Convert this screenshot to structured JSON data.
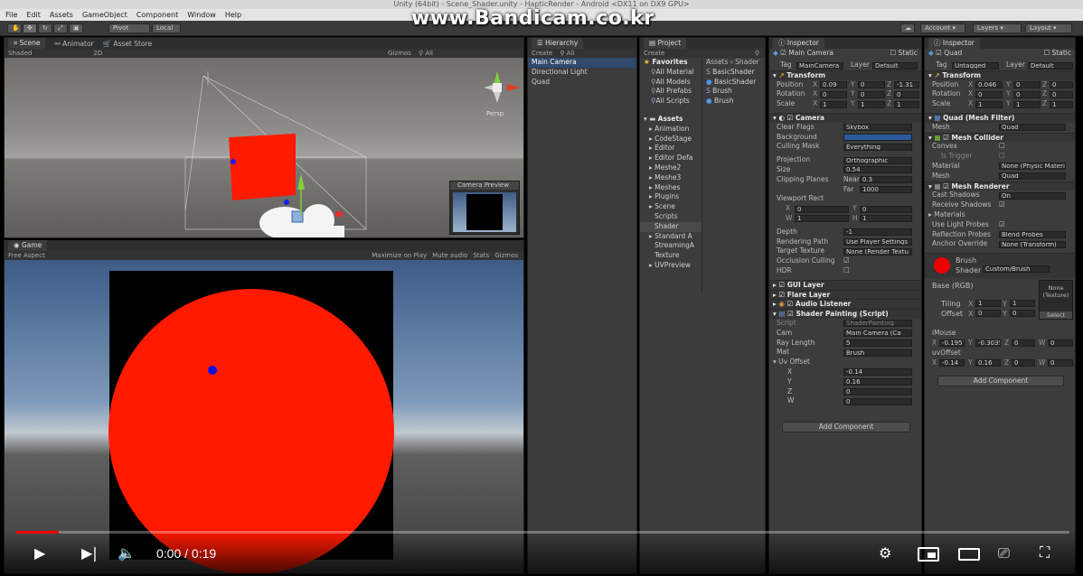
{
  "window": {
    "title": "Unity (64bit) - Scene_Shader.unity - HapticRender - Android <DX11 on DX9 GPU>"
  },
  "watermark": "www.Bandicam.co.kr",
  "menu": [
    "File",
    "Edit",
    "Assets",
    "GameObject",
    "Component",
    "Window",
    "Help"
  ],
  "toolbar": {
    "pivot": "Pivot",
    "local": "Local",
    "account": "Account",
    "layers": "Layers",
    "layout": "Layout"
  },
  "scene": {
    "tabs": [
      "Scene",
      "Animator",
      "Asset Store"
    ],
    "shading": "Shaded",
    "mode2d": "2D",
    "gizmos": "Gizmos",
    "search": "All",
    "persp": "Persp",
    "camera_preview": "Camera Preview"
  },
  "game": {
    "tab": "Game",
    "aspect": "Free Aspect",
    "options": [
      "Maximize on Play",
      "Mute audio",
      "Stats",
      "Gizmos"
    ]
  },
  "hierarchy": {
    "tab": "Hierarchy",
    "create": "Create",
    "search": "All",
    "items": [
      "Main Camera",
      "Directional Light",
      "Quad"
    ]
  },
  "project": {
    "tab": "Project",
    "create": "Create",
    "favorites_label": "Favorites",
    "favorites": [
      "All Material",
      "All Models",
      "All Prefabs",
      "All Scripts"
    ],
    "breadcrumb": "Assets › Shader",
    "files": [
      "BasicShader",
      "BasicShader",
      "Brush",
      "Brush"
    ],
    "assets_label": "Assets",
    "folders": [
      "Animation",
      "CodeStage",
      "Editor",
      "Editor Defa",
      "Meshe2",
      "Meshe3",
      "Meshes",
      "Plugins",
      "Scene",
      "Scripts",
      "Shader",
      "Standard A",
      "StreamingA",
      "Texture",
      "UVPreview"
    ]
  },
  "inspector1": {
    "tab": "Inspector",
    "object_name": "Main Camera",
    "static": "Static",
    "tag_label": "Tag",
    "tag": "MainCamera",
    "layer_label": "Layer",
    "layer": "Default",
    "transform": {
      "title": "Transform",
      "position": [
        "0.09",
        "0",
        "-1.31"
      ],
      "rotation": [
        "0",
        "0",
        "0"
      ],
      "scale": [
        "1",
        "1",
        "1"
      ]
    },
    "camera": {
      "title": "Camera",
      "clear_flags_label": "Clear Flags",
      "clear_flags": "Skybox",
      "background_label": "Background",
      "culling_label": "Culling Mask",
      "culling": "Everything",
      "projection_label": "Projection",
      "projection": "Orthographic",
      "size_label": "Size",
      "size": "0.54",
      "clipping_label": "Clipping Planes",
      "near_label": "Near",
      "near": "0.3",
      "far_label": "Far",
      "far": "1000",
      "viewport_label": "Viewport Rect",
      "vp_x": "0",
      "vp_y": "0",
      "vp_w": "1",
      "vp_h": "1",
      "depth_label": "Depth",
      "depth": "-1",
      "rendering_label": "Rendering Path",
      "rendering": "Use Player Settings",
      "target_label": "Target Texture",
      "target": "None (Render Textu",
      "occlusion_label": "Occlusion Culling",
      "hdr_label": "HDR"
    },
    "components": [
      "GUI Layer",
      "Flare Layer",
      "Audio Listener"
    ],
    "shader_painting": {
      "title": "Shader Painting (Script)",
      "script_label": "Script",
      "script": "ShaderPainting",
      "cam_label": "Cam",
      "cam": "Main Camera (Ca",
      "ray_label": "Ray Length",
      "ray": "5",
      "mat_label": "Mat",
      "mat": "Brush",
      "uv_label": "Uv Offset",
      "uv": [
        {
          "k": "X",
          "v": "-0.14"
        },
        {
          "k": "Y",
          "v": "0.16"
        },
        {
          "k": "Z",
          "v": "0"
        },
        {
          "k": "W",
          "v": "0"
        }
      ]
    },
    "add_component": "Add Component"
  },
  "inspector2": {
    "tab": "Inspector",
    "object_name": "Quad",
    "static": "Static",
    "tag_label": "Tag",
    "tag": "Untagged",
    "layer_label": "Layer",
    "layer": "Default",
    "transform": {
      "title": "Transform",
      "position": [
        "0.046",
        "0",
        "0"
      ],
      "rotation": [
        "0",
        "0",
        "0"
      ],
      "scale": [
        "1",
        "1",
        "1"
      ]
    },
    "mesh_filter": {
      "title": "Quad (Mesh Filter)",
      "mesh_label": "Mesh",
      "mesh": "Quad"
    },
    "mesh_collider": {
      "title": "Mesh Collider",
      "convex_label": "Convex",
      "trigger_label": "Is Trigger",
      "material_label": "Material",
      "material": "None (Physic Materi",
      "mesh_label": "Mesh",
      "mesh": "Quad"
    },
    "mesh_renderer": {
      "title": "Mesh Renderer",
      "cast_label": "Cast Shadows",
      "cast": "On",
      "receive_label": "Receive Shadows",
      "materials_label": "Materials",
      "probes_label": "Use Light Probes",
      "reflection_label": "Reflection Probes",
      "reflection": "Blend Probes",
      "anchor_label": "Anchor Override",
      "anchor": "None (Transform)"
    },
    "material": {
      "name": "Brush",
      "shader_label": "Shader",
      "shader": "Custom/Brush",
      "base_label": "Base (RGB)",
      "texture": "None (Texture)",
      "select": "Select",
      "tiling_label": "Tiling",
      "tiling_x": "1",
      "tiling_y": "1",
      "offset_label": "Offset",
      "offset_x": "0",
      "offset_y": "0",
      "imouse_label": "iMouse",
      "imouse": [
        "-0.1957",
        "-0.3035",
        "0",
        "0"
      ],
      "uvoffset_label": "uvOffset",
      "uvoffset": [
        "-0.14",
        "0.16",
        "0",
        "0"
      ]
    },
    "add_component": "Add Component"
  },
  "player": {
    "time": "0:00 / 0:19",
    "progress": 0.04
  },
  "colors": {
    "red": "#ff1a00",
    "blue": "#1010e0",
    "unity_bg": "#3c3c3c"
  }
}
